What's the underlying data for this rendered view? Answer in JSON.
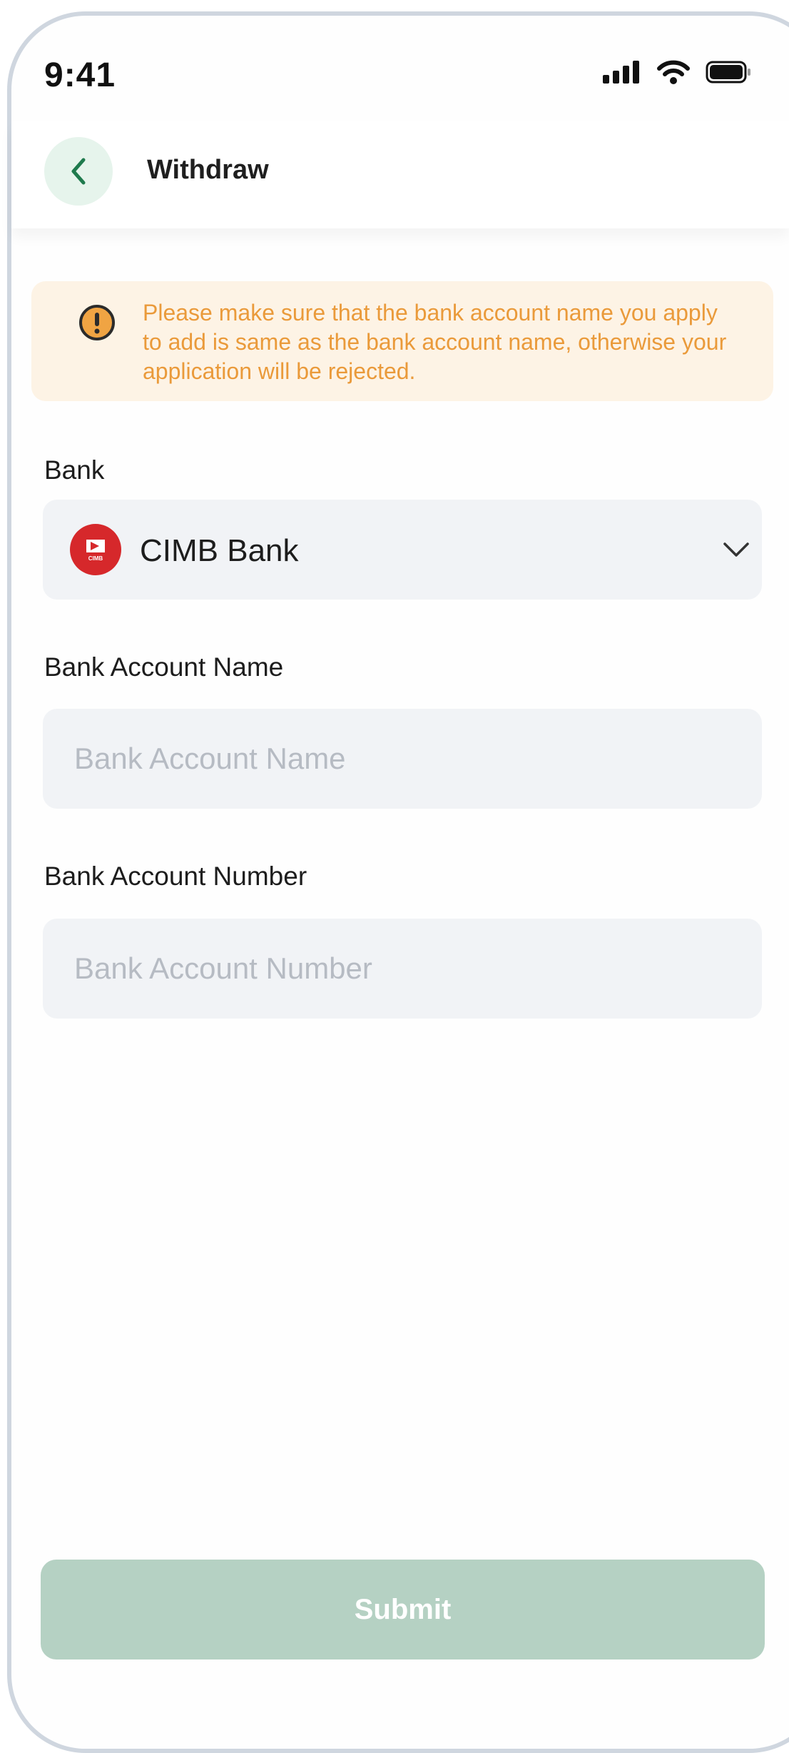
{
  "status_bar": {
    "time": "9:41",
    "icons": [
      "signal-icon",
      "wifi-icon",
      "battery-icon"
    ]
  },
  "header": {
    "title": "Withdraw",
    "back_icon": "chevron-left-icon"
  },
  "notice": {
    "icon": "exclamation-icon",
    "text": "Please make sure that the bank account name you apply to add is same as the bank account name, otherwise your application will be rejected."
  },
  "form": {
    "bank": {
      "label": "Bank",
      "selected": "CIMB Bank",
      "logo_text": "CIMB"
    },
    "account_name": {
      "label": "Bank Account Name",
      "value": "",
      "placeholder": "Bank Account Name"
    },
    "account_number": {
      "label": "Bank Account Number",
      "value": "",
      "placeholder": "Bank Account Number"
    }
  },
  "submit_label": "Submit",
  "colors": {
    "accent_green": "#1f7a4d",
    "back_bg": "#e6f4ec",
    "notice_bg": "#fdf3e5",
    "notice_text": "#ea9a3a",
    "notice_icon": "#f0a443",
    "field_bg": "#f1f3f6",
    "submit_disabled": "#b5d1c3",
    "bank_red": "#d6282b"
  }
}
